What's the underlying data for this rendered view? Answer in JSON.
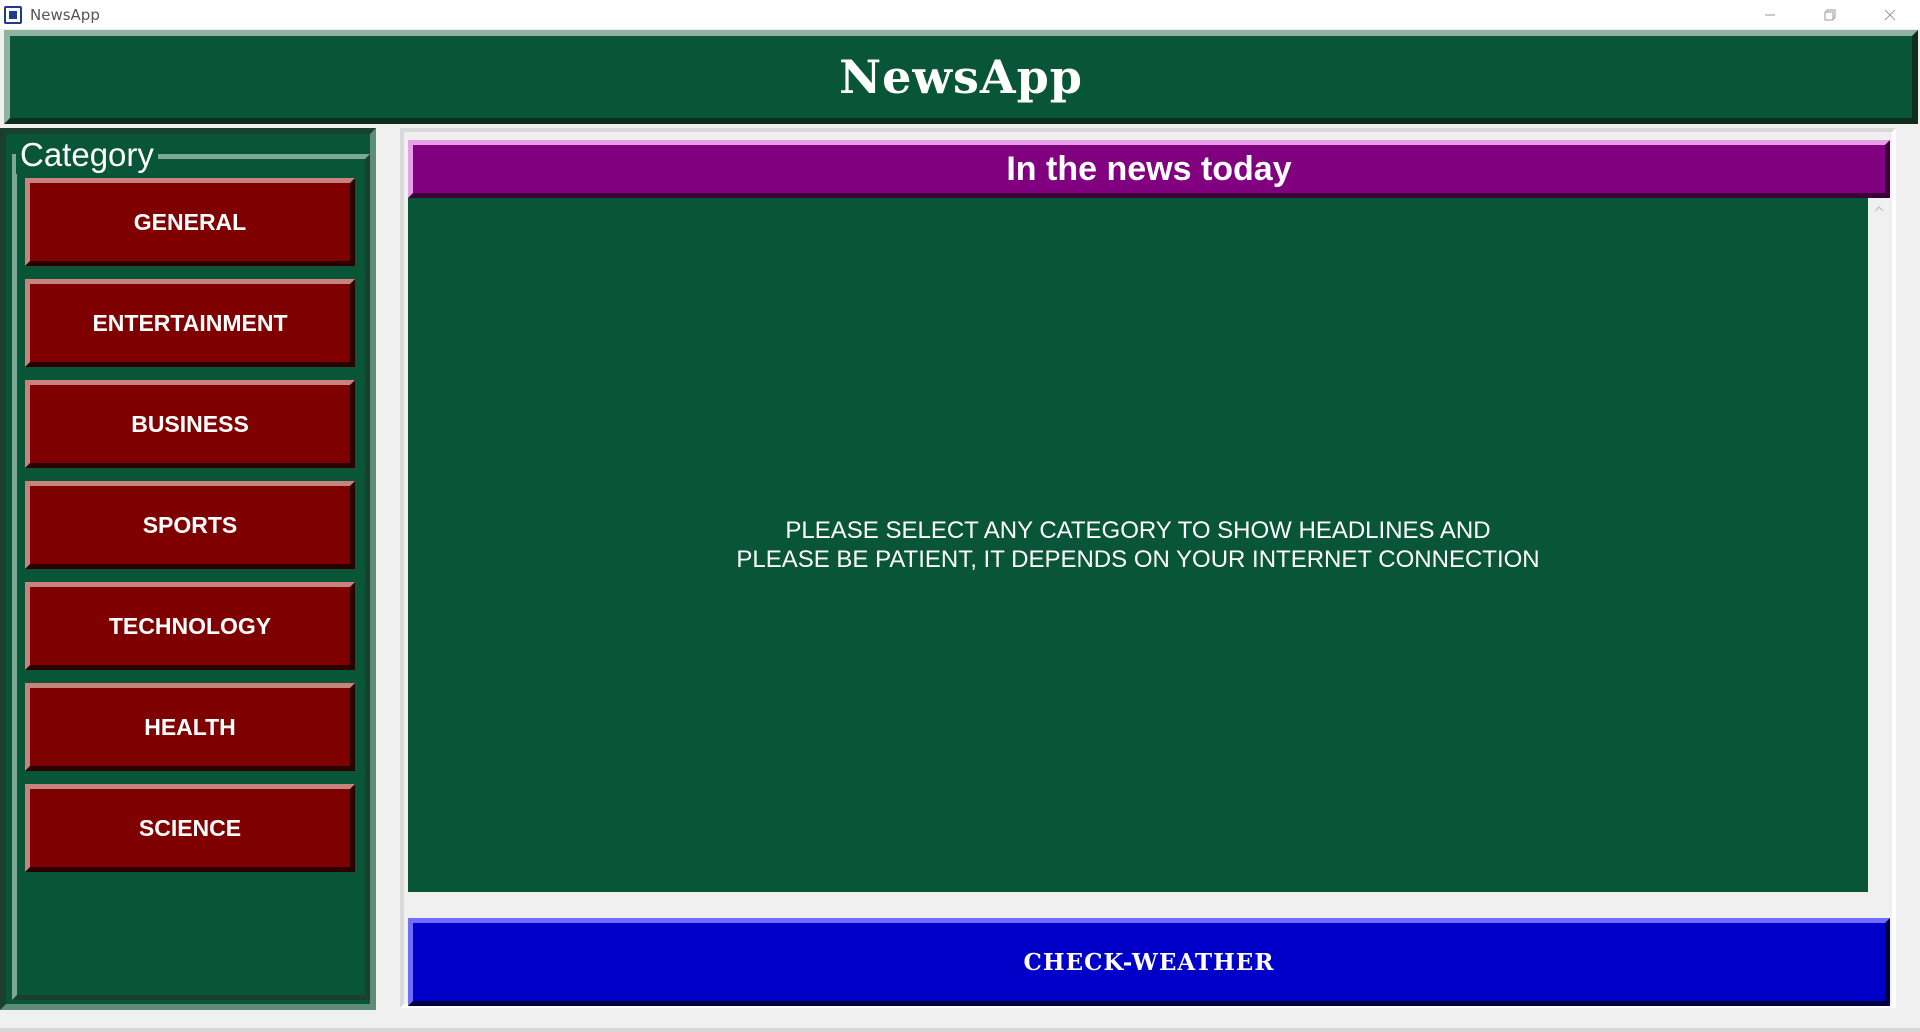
{
  "window": {
    "title": "NewsApp",
    "controls": [
      "minimize-icon",
      "restore-icon",
      "close-icon"
    ]
  },
  "header": {
    "title": "NewsApp"
  },
  "sidebar": {
    "legend": "Category",
    "items": [
      {
        "label": "GENERAL"
      },
      {
        "label": "ENTERTAINMENT"
      },
      {
        "label": "BUSINESS"
      },
      {
        "label": "SPORTS"
      },
      {
        "label": "TECHNOLOGY"
      },
      {
        "label": "HEALTH"
      },
      {
        "label": "SCIENCE"
      }
    ]
  },
  "news": {
    "heading": "In the news today",
    "message_line1": "PLEASE SELECT ANY CATEGORY TO SHOW HEADLINES AND",
    "message_line2": "PLEASE BE PATIENT, IT DEPENDS ON YOUR INTERNET CONNECTION"
  },
  "actions": {
    "weather_label": "CHECK-WEATHER"
  },
  "colors": {
    "panel_green": "#085537",
    "category_red": "#7f0000",
    "heading_purple": "#800080",
    "weather_blue": "#0000c8"
  }
}
